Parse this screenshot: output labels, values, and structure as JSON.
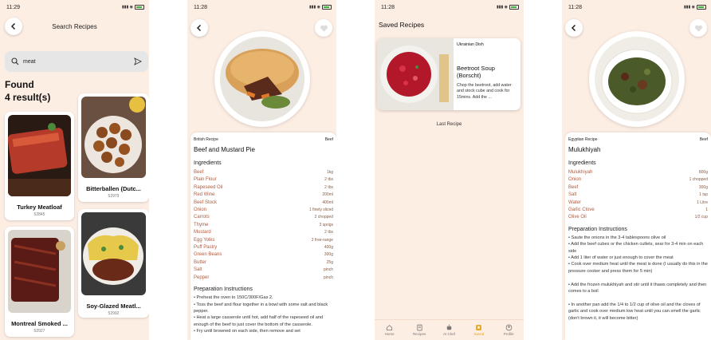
{
  "status": {
    "p1_time": "11:29",
    "p2_time": "11:28",
    "p3_time": "11:28",
    "p4_time": "11:28"
  },
  "search_screen": {
    "title": "Search Recipes",
    "query": "meat",
    "found_label": "Found",
    "results_count": "4 result(s)",
    "results": [
      {
        "name": "Turkey Meatloaf",
        "id": "52845"
      },
      {
        "name": "Bitterballen (Dutc...",
        "id": "52979"
      },
      {
        "name": "Montreal Smoked ...",
        "id": "52927"
      },
      {
        "name": "Soy-Glazed Meatl...",
        "id": "52992"
      }
    ]
  },
  "detail1": {
    "origin": "British Recipe",
    "category": "Beef",
    "name": "Beef and Mustard Pie",
    "ingredients_header": "Ingredients",
    "ingredients": [
      {
        "n": "Beef",
        "q": "1kg"
      },
      {
        "n": "Plain Flour",
        "q": "2 tbs"
      },
      {
        "n": "Rapeseed Oil",
        "q": "2 tbs"
      },
      {
        "n": "Red Wine",
        "q": "200ml"
      },
      {
        "n": "Beef Stock",
        "q": "400ml"
      },
      {
        "n": "Onion",
        "q": "1 finely sliced"
      },
      {
        "n": "Carrots",
        "q": "2 chopped"
      },
      {
        "n": "Thyme",
        "q": "3 sprigs"
      },
      {
        "n": "Mustard",
        "q": "2 tbs"
      },
      {
        "n": "Egg Yolks",
        "q": "2 free-range"
      },
      {
        "n": "Puff Pastry",
        "q": "400g"
      },
      {
        "n": "Green Beans",
        "q": "300g"
      },
      {
        "n": "Butter",
        "q": "25g"
      },
      {
        "n": "Salt",
        "q": "pinch"
      },
      {
        "n": "Pepper",
        "q": "pinch"
      }
    ],
    "instructions_header": "Preparation Instructions",
    "instructions": "• Preheat the oven to 150C/300F/Gas 2.\n• Toss the beef and flour together in a bowl with some salt and black pepper.\n• Heat a large casserole until hot, add half of the rapeseed oil and enough of the beef to just cover the bottom of the casserole.\n• Fry until browned on each side, then remove and set"
  },
  "saved_screen": {
    "title": "Saved Recipes",
    "card": {
      "category": "Ukrainian Dish",
      "name": "Beetroot Soup (Borscht)",
      "desc": "Chop the beetroot, add water and stock cube and cook for 15mins. Add the ..."
    },
    "last_label": "Last Recipe",
    "nav": [
      {
        "label": "Home",
        "icon": "home-icon"
      },
      {
        "label": "Recipes",
        "icon": "book-icon"
      },
      {
        "label": "AI Chef",
        "icon": "robot-icon"
      },
      {
        "label": "Saved",
        "icon": "bookmark-icon"
      },
      {
        "label": "Profile",
        "icon": "profile-icon"
      }
    ],
    "nav_active": "Saved"
  },
  "detail2": {
    "origin": "Egyptian Recipe",
    "category": "Beef",
    "name": "Mulukhiyah",
    "ingredients_header": "Ingredients",
    "ingredients": [
      {
        "n": "Mulukhiyah",
        "q": "800g"
      },
      {
        "n": "Onion",
        "q": "1 chopped"
      },
      {
        "n": "Beef",
        "q": "300g"
      },
      {
        "n": "Salt",
        "q": "1 tsp"
      },
      {
        "n": "Water",
        "q": "1 Litre"
      },
      {
        "n": "Garlic Clove",
        "q": "1"
      },
      {
        "n": "Olive Oil",
        "q": "1/2 cup"
      }
    ],
    "instructions_header": "Preparation Instructions",
    "instructions": "• Saute the onions in the 3-4 tablespoons olive oil\n• Add the beef cubes or the chicken cutlets, sear for 3-4 min on each side\n• Add 1 liter of water or just enough to cover the meat\n• Cook over medium heat until the meat is done (I usually do this in the pressure cooker and press them for 5 min)\n\n• Add the frozen mulukhiyah and stir until it thaws completely and then comes to a boil\n\n• In another pan add the 1/4 to 1/2 cup of olive oil and the cloves of garlic and cook over medium low heat until you can smell the garlic (don't brown it, it will become bitter)"
  },
  "colors": {
    "background": "#fdeee4",
    "accent": "#e3a21a",
    "ingredient": "#b5593a"
  }
}
